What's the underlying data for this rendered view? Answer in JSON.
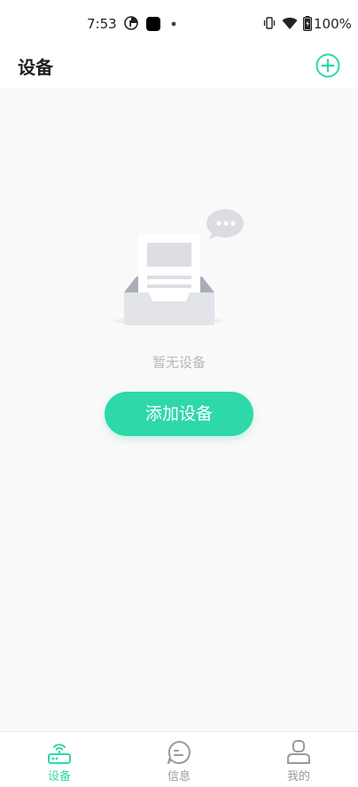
{
  "status_bar": {
    "time": "7:53",
    "battery": "100%",
    "icons": [
      "pie-status-icon",
      "notification-square-icon",
      "dot-icon",
      "vibrate-icon",
      "wifi-icon",
      "battery-icon"
    ]
  },
  "header": {
    "title": "设备",
    "add_icon": "plus-circle-icon"
  },
  "empty_state": {
    "message": "暂无设备",
    "button_label": "添加设备",
    "illustration_icon": "empty-inbox-with-chat-bubble"
  },
  "bottom_nav": {
    "items": [
      {
        "label": "设备",
        "icon": "router-icon",
        "active": true
      },
      {
        "label": "信息",
        "icon": "chat-icon",
        "active": false
      },
      {
        "label": "我的",
        "icon": "user-icon",
        "active": false
      }
    ]
  },
  "colors": {
    "accent": "#2fd8a8",
    "nav_active": "#2fd8a8",
    "nav_inactive": "#9a9a9a",
    "empty_text": "#b9b9b9"
  }
}
